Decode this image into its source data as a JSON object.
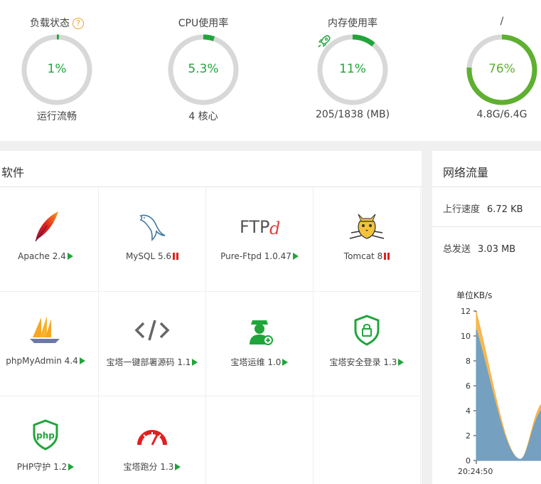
{
  "gauges": [
    {
      "title": "负载状态",
      "help": "?",
      "value": "1%",
      "percent": 1,
      "sub": "运行流畅",
      "color": "#20a53a"
    },
    {
      "title": "CPU使用率",
      "value": "5.3%",
      "percent": 5.3,
      "sub": "4 核心",
      "color": "#20a53a"
    },
    {
      "title": "内存使用率",
      "value": "11%",
      "percent": 11,
      "sub": "205/1838 (MB)",
      "color": "#20a53a",
      "icon": "rocket-icon"
    },
    {
      "title": "/",
      "value": "76%",
      "percent": 76,
      "sub": "4.8G/6.4G",
      "color": "#5fb030"
    }
  ],
  "software": {
    "title": "软件",
    "items": [
      {
        "name": "Apache 2.4",
        "status": "running",
        "icon": "feather-icon"
      },
      {
        "name": "MySQL 5.6",
        "status": "stopped",
        "icon": "dolphin-icon"
      },
      {
        "name": "Pure-Ftpd 1.0.47",
        "status": "running",
        "icon": "ftpd-logo-icon",
        "logo_text": "FTP",
        "logo_accent": "d"
      },
      {
        "name": "Tomcat 8",
        "status": "stopped",
        "icon": "tomcat-cat-icon"
      },
      {
        "name": "phpMyAdmin 4.4",
        "status": "running",
        "icon": "sailboat-icon"
      },
      {
        "name": "宝塔一键部署源码 1.1",
        "status": "running",
        "icon": "code-brackets-icon"
      },
      {
        "name": "宝塔运维 1.0",
        "status": "running",
        "icon": "operator-icon"
      },
      {
        "name": "宝塔安全登录 1.3",
        "status": "running",
        "icon": "shield-lock-icon"
      },
      {
        "name": "PHP守护 1.2",
        "status": "running",
        "icon": "php-shield-icon",
        "logo_text": "php"
      },
      {
        "name": "宝塔跑分 1.3",
        "status": "running",
        "icon": "speedometer-icon"
      }
    ]
  },
  "network": {
    "title": "网络流量",
    "up_label": "上行速度",
    "up_value": "6.72 KB",
    "sent_label": "总发送",
    "sent_value": "3.03 MB",
    "chart_unit": "单位KB/s"
  },
  "chart_data": {
    "type": "area",
    "ylim": [
      0,
      12
    ],
    "yticks": [
      0,
      2,
      4,
      6,
      8,
      10,
      12
    ],
    "x_first_label": "20:24:50",
    "series": [
      {
        "color": "#f5b041",
        "values": [
          11.9,
          0.1,
          4.5
        ]
      },
      {
        "color": "#6f9ec5",
        "values": [
          10.5,
          0.1,
          4.0
        ]
      }
    ]
  },
  "colors": {
    "accent": "#20a53a",
    "stopped": "#e02020",
    "track": "#d8d8d8"
  }
}
